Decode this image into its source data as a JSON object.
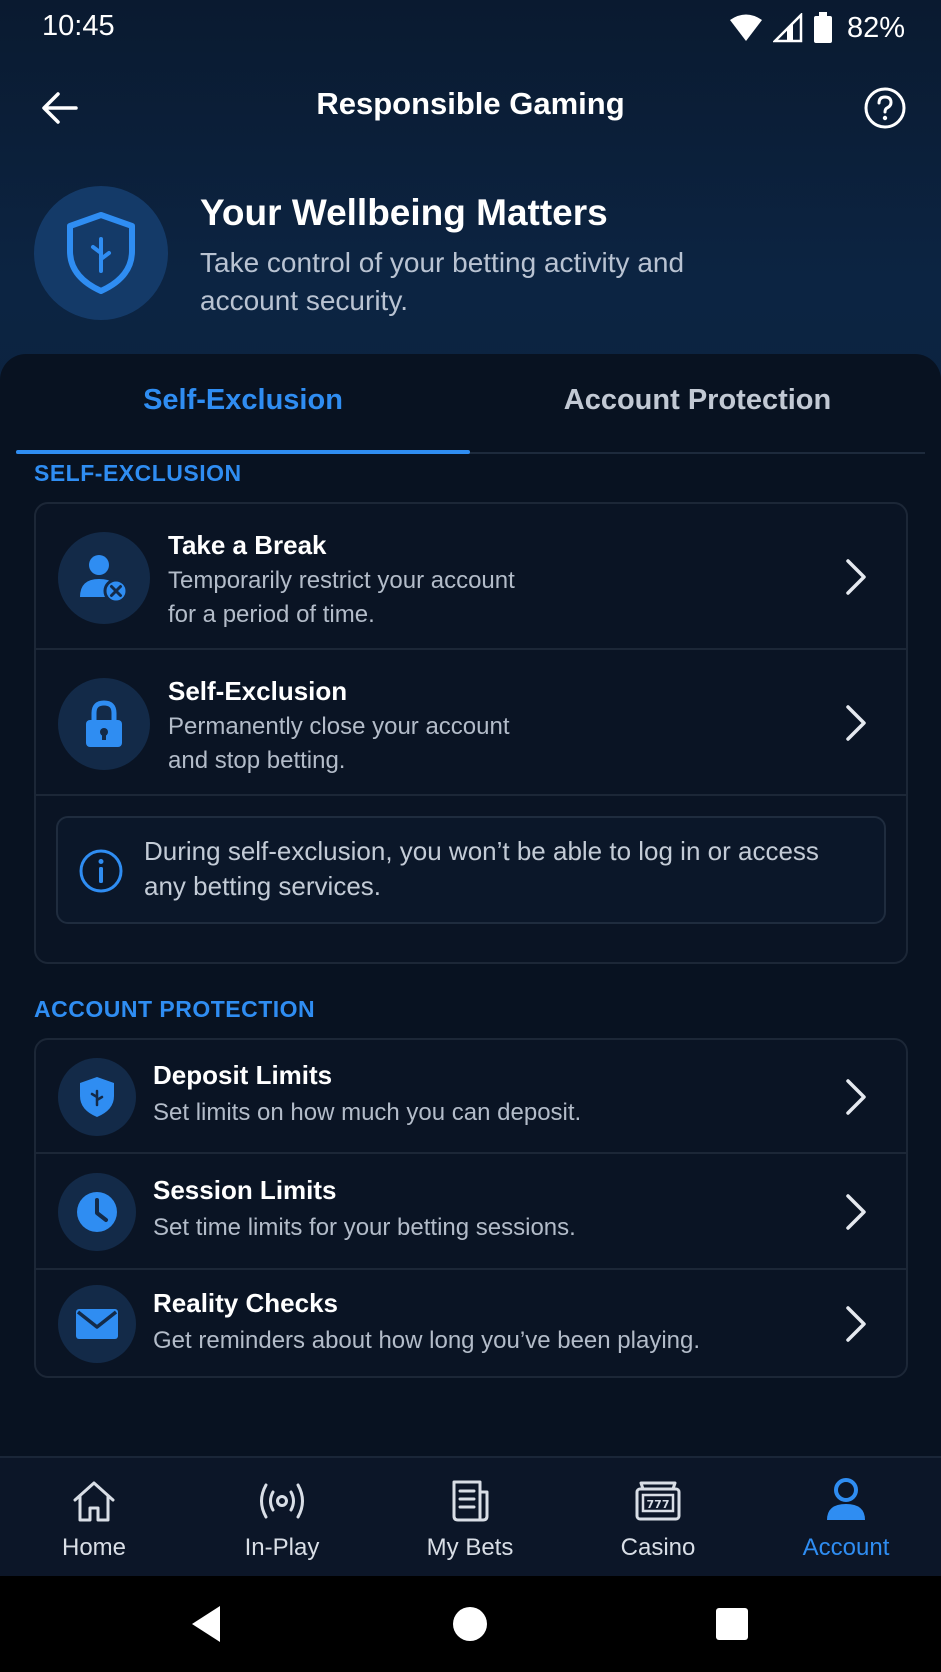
{
  "status_bar": {
    "time": "10:45",
    "battery": "82%"
  },
  "app_bar": {
    "title": "Responsible Gaming",
    "back_icon": "arrow-left-icon",
    "help_icon": "help-circle-icon"
  },
  "hero": {
    "icon": "shield-icon",
    "title": "Your Wellbeing Matters",
    "subtitle": "Take control of your betting activity and account security."
  },
  "tabs": [
    {
      "label": "Self-Exclusion",
      "active": true
    },
    {
      "label": "Account Protection",
      "active": false
    }
  ],
  "self_exclusion": {
    "section_label": "SELF-EXCLUSION",
    "items": [
      {
        "title": "Take a Break",
        "description": "Temporarily restrict your account for a period of time.",
        "icon": "user-block-icon"
      },
      {
        "title": "Self-Exclusion",
        "description": "Permanently close your account and stop betting.",
        "icon": "lock-icon"
      }
    ],
    "info": "During self-exclusion, you won’t be able to log in or access any betting services."
  },
  "account_protection": {
    "section_label": "ACCOUNT PROTECTION",
    "items": [
      {
        "title": "Deposit Limits",
        "description": "Set limits on how much you can deposit.",
        "icon": "shield-icon"
      },
      {
        "title": "Session Limits",
        "description": "Set time limits for your betting sessions.",
        "icon": "clock-icon"
      },
      {
        "title": "Reality Checks",
        "description": "Get reminders about how long you’ve been playing.",
        "icon": "mail-icon"
      }
    ]
  },
  "bottom_nav": [
    {
      "label": "Home",
      "icon": "home-icon",
      "active": false
    },
    {
      "label": "In-Play",
      "icon": "broadcast-icon",
      "active": false
    },
    {
      "label": "My Bets",
      "icon": "betslip-icon",
      "active": false
    },
    {
      "label": "Casino",
      "icon": "slot-machine-icon",
      "active": false
    },
    {
      "label": "Account",
      "icon": "user-icon",
      "active": true
    }
  ],
  "colors": {
    "accent": "#2f8df2",
    "background": "#081221",
    "card": "#0a1424"
  }
}
